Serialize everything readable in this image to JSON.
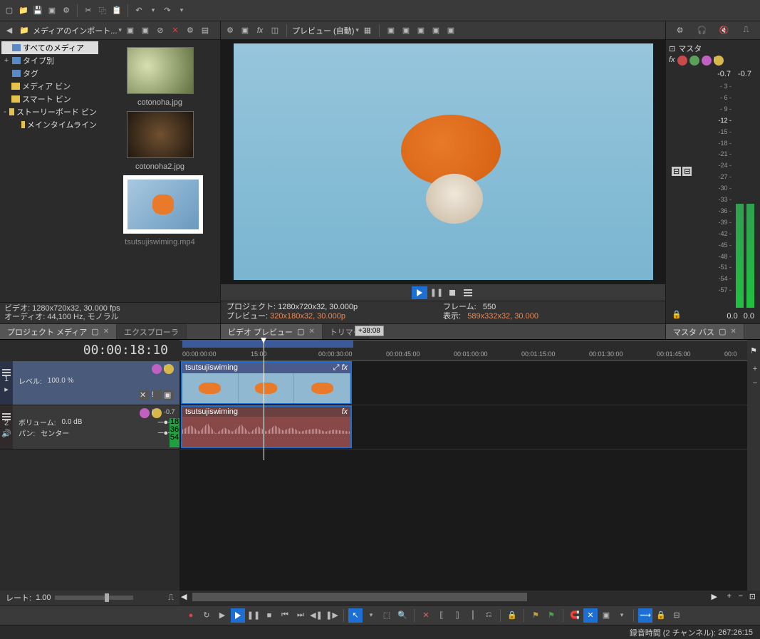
{
  "toolbar": {
    "media_import": "メディアのインポート..."
  },
  "media_tree": {
    "all": "すべてのメディア",
    "by_type": "タイプ別",
    "tags": "タグ",
    "media_bin": "メディア ビン",
    "smart_bin": "スマート ビン",
    "storyboard_bin": "ストーリーボード ビン",
    "main_timeline": "メインタイムライン"
  },
  "media_items": [
    {
      "label": "cotonoha.jpg"
    },
    {
      "label": "cotonoha2.jpg"
    },
    {
      "label": "tsutsujiswiming.mp4",
      "selected": true
    }
  ],
  "media_info": {
    "video": "ビデオ: 1280x720x32, 30.000 fps",
    "audio": "オーディオ: 44,100 Hz, モノラル"
  },
  "tabs_left": {
    "project_media": "プロジェクト メディア",
    "explorer": "エクスプローラ"
  },
  "preview_toolbar": {
    "preview_label": "プレビュー (自動)"
  },
  "tabs_center": {
    "video_preview": "ビデオ プレビュー",
    "trimmer": "トリマー"
  },
  "preview_info": {
    "project_l": "プロジェクト:",
    "project_v": "1280x720x32, 30.000p",
    "preview_l": "プレビュー:",
    "preview_v": "320x180x32, 30.000p",
    "frame_l": "フレーム:",
    "frame_v": "550",
    "display_l": "表示:",
    "display_v": "589x332x32, 30.000"
  },
  "master": {
    "label": "マスタ",
    "val_l": "-0.7",
    "val_r": "-0.7",
    "bottom_l": "0.0",
    "bottom_r": "0.0",
    "scale": [
      "- 3 -",
      "- 6 -",
      "- 9 -",
      "-12 -",
      "-15 -",
      "-18 -",
      "-21 -",
      "-24 -",
      "-27 -",
      "-30 -",
      "-33 -",
      "-36 -",
      "-39 -",
      "-42 -",
      "-45 -",
      "-48 -",
      "-51 -",
      "-54 -",
      "-57 -"
    ]
  },
  "tabs_right": {
    "master_bus": "マスタ バス"
  },
  "timeline": {
    "cursor_time": "00:00:18:10",
    "loop_end_badge": "+38:08",
    "ruler": [
      "00:00:00:00",
      "15:00",
      "00:00:30:00",
      "00:00:45:00",
      "00:01:00:00",
      "00:01:15:00",
      "00:01:30:00",
      "00:01:45:00",
      "00:0"
    ],
    "track1": {
      "num": "1",
      "level_l": "レベル:",
      "level_v": "100.0 %"
    },
    "track2": {
      "num": "2",
      "vol_l": "ボリューム:",
      "vol_v": "0.0 dB",
      "pan_l": "パン:",
      "pan_v": "センター",
      "peak": "-0.7",
      "m1": "18",
      "m2": "36",
      "m3": "54"
    },
    "clip_name": "tsutsujiswiming",
    "rate_l": "レート:",
    "rate_v": "1.00"
  },
  "status": {
    "rec_time_l": "録音時間 (2 チャンネル):",
    "rec_time_v": "267:26:15"
  }
}
